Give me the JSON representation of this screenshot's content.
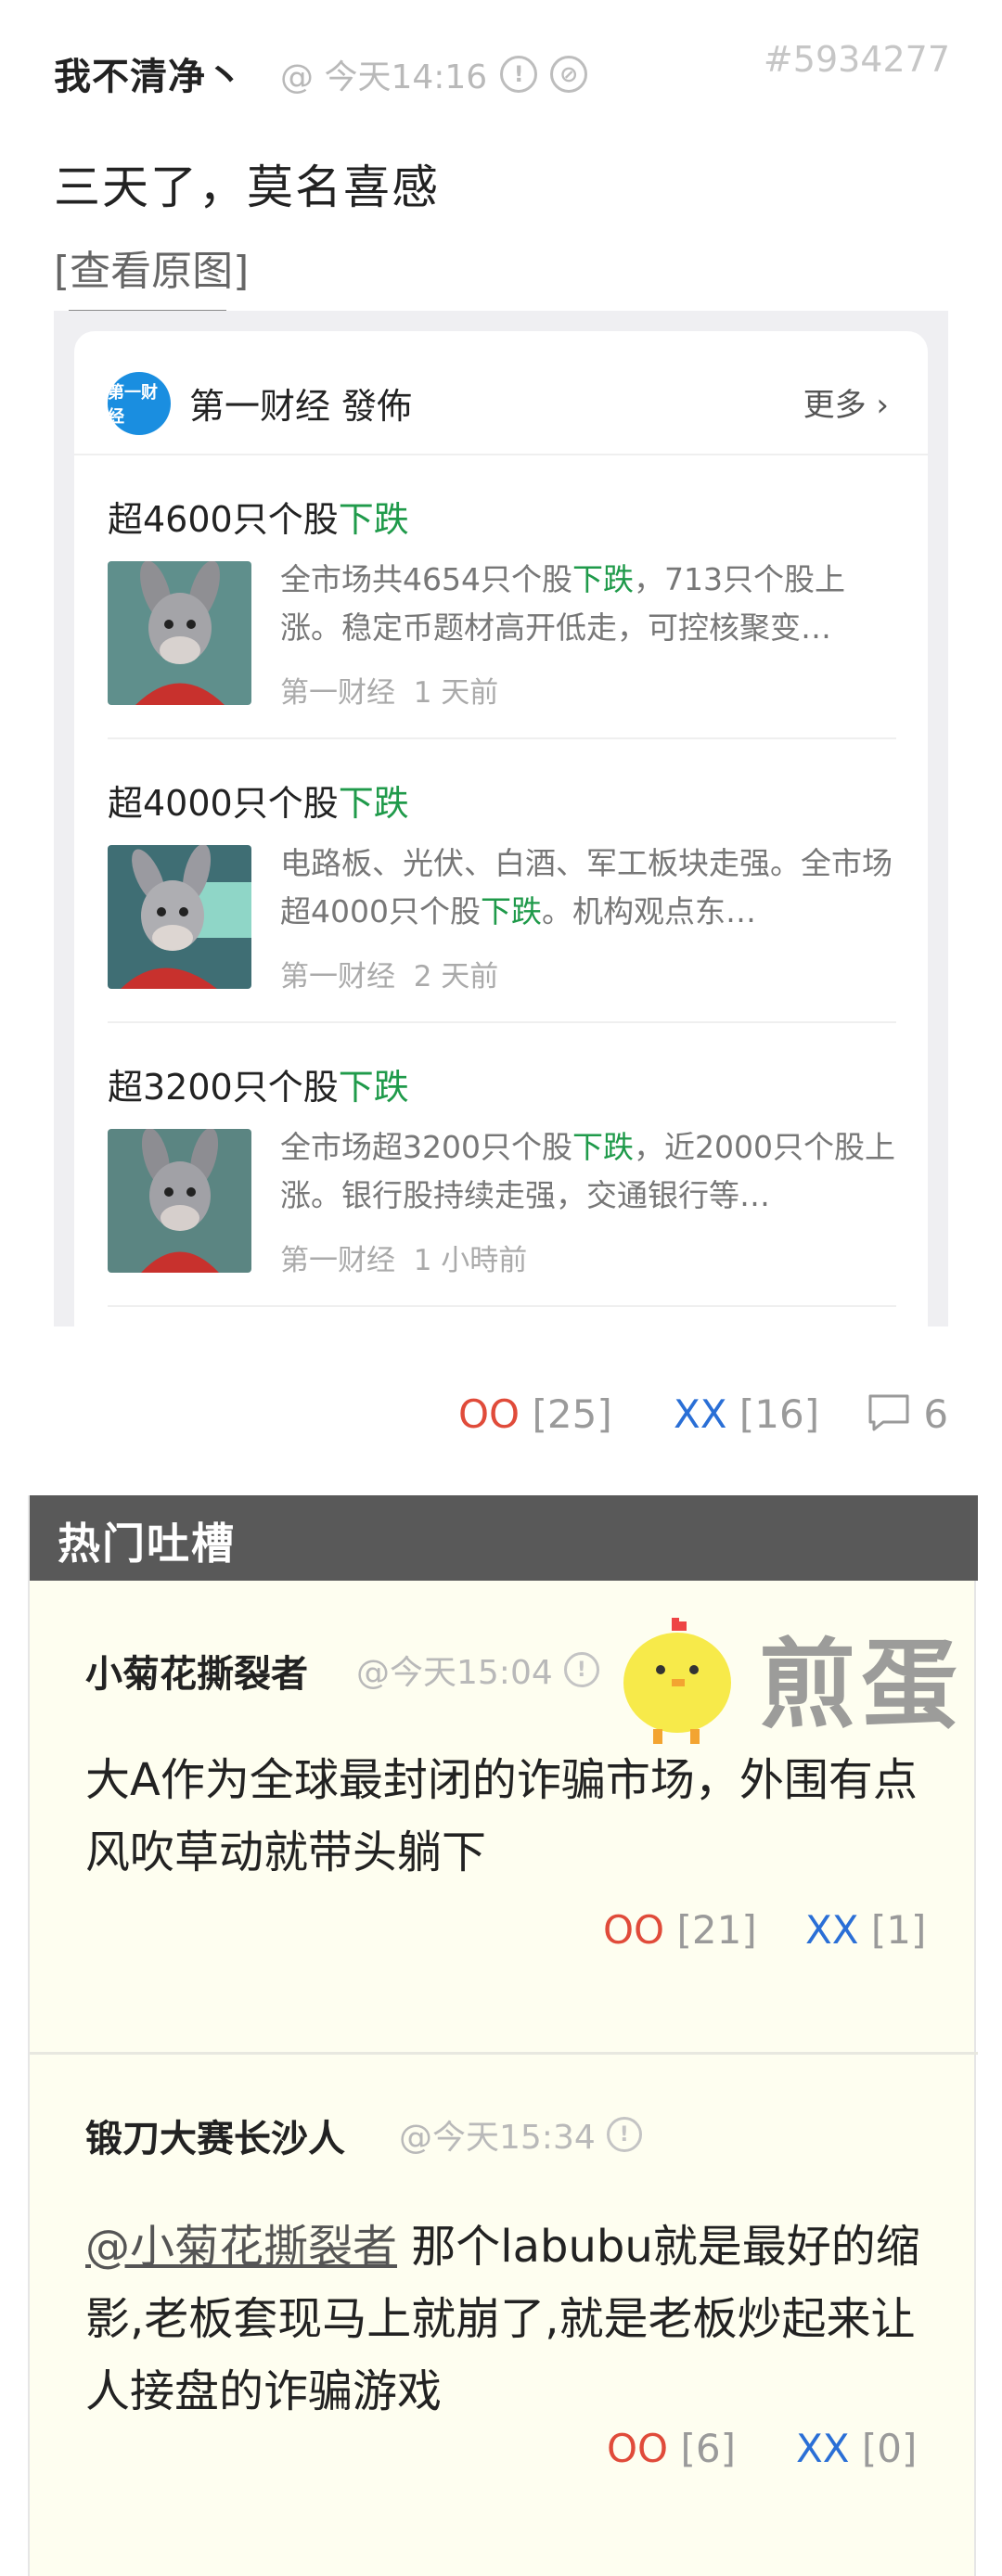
{
  "post": {
    "author": "我不清净丶",
    "time": "@ 今天14:16",
    "id": "#5934277",
    "text": "三天了，莫名喜感",
    "view_original": "[查看原图]",
    "votes": {
      "oo_label": "OO",
      "oo_count": "[25]",
      "xx_label": "XX",
      "xx_count": "[16]",
      "comment_count": "6"
    }
  },
  "screenshot": {
    "source_logo_text": "第一财经",
    "source_name": "第一财经 發佈",
    "more_label": "更多",
    "items": [
      {
        "title_prefix": "超4600只个股",
        "title_highlight": "下跌",
        "desc_a": "全市场共4654只个股",
        "desc_hl": "下跌",
        "desc_b": "，713只个股上涨。稳定币题材高开低走，可控核聚变…",
        "source": "第一财经",
        "time": "1 天前",
        "thumb_icon": "donkey-cartoon"
      },
      {
        "title_prefix": "超4000只个股",
        "title_highlight": "下跌",
        "desc_a": "电路板、光伏、白酒、军工板块走强。全市场超4000只个股",
        "desc_hl": "下跌",
        "desc_b": "。机构观点东…",
        "source": "第一财经",
        "time": "2 天前",
        "thumb_icon": "donkey-cartoon"
      },
      {
        "title_prefix": "超3200只个股",
        "title_highlight": "下跌",
        "desc_a": "全市场超3200只个股",
        "desc_hl": "下跌",
        "desc_b": "，近2000只个股上涨。银行股持续走强，交通银行等…",
        "source": "第一财经",
        "time": "1 小時前",
        "thumb_icon": "donkey-cartoon"
      }
    ]
  },
  "hot": {
    "title": "热门吐槽",
    "watermark": "煎蛋",
    "comments": [
      {
        "author": "小菊花撕裂者",
        "time": "@今天15:04",
        "mention": "",
        "body": "大A作为全球最封闭的诈骗市场，外围有点风吹草动就带头躺下",
        "oo_label": "OO",
        "oo_count": "[21]",
        "xx_label": "XX",
        "xx_count": "[1]"
      },
      {
        "author": "锻刀大赛长沙人",
        "time": "@今天15:34",
        "mention": "@小菊花撕裂者",
        "body": " 那个labubu就是最好的缩影,老板套现马上就崩了,就是老板炒起来让人接盘的诈骗游戏",
        "oo_label": "OO",
        "oo_count": "[6]",
        "xx_label": "XX",
        "xx_count": "[0]"
      }
    ]
  },
  "colors": {
    "oo": "#e04b3a",
    "xx": "#2a6fd6",
    "down_green": "#1f9a4a",
    "hot_header": "#595959",
    "comment_bg": "#fefef0"
  }
}
